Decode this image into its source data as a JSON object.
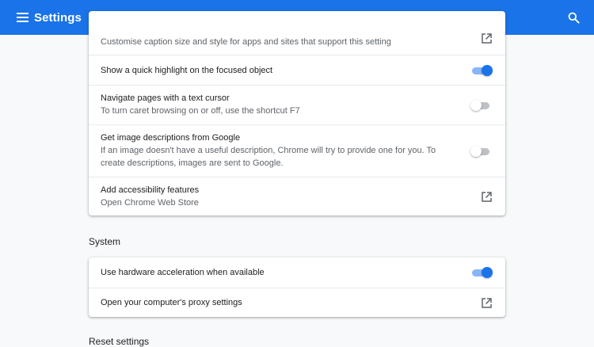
{
  "header": {
    "title": "Settings",
    "menu_icon": "hamburger-menu-icon",
    "search_icon": "search-icon",
    "background": "#1a73e8"
  },
  "accessibility": {
    "items": [
      {
        "primary": "",
        "secondary": "Customise caption size and style for apps and sites that support this setting",
        "control": "external-link"
      },
      {
        "primary": "Show a quick highlight on the focused object",
        "control": "toggle",
        "state": "on"
      },
      {
        "primary": "Navigate pages with a text cursor",
        "secondary": "To turn caret browsing on or off, use the shortcut F7",
        "control": "toggle",
        "state": "off"
      },
      {
        "primary": "Get image descriptions from Google",
        "secondary": "If an image doesn't have a useful description, Chrome will try to provide one for you. To create descriptions, images are sent to Google.",
        "control": "toggle",
        "state": "off"
      },
      {
        "primary": "Add accessibility features",
        "secondary": "Open Chrome Web Store",
        "control": "external-link"
      }
    ]
  },
  "system": {
    "title": "System",
    "items": [
      {
        "primary": "Use hardware acceleration when available",
        "control": "toggle",
        "state": "on"
      },
      {
        "primary": "Open your computer's proxy settings",
        "control": "external-link"
      }
    ]
  },
  "next_section": {
    "title": "Reset settings"
  },
  "colors": {
    "accent": "#1a73e8",
    "toggle_on_track": "#8ab4f8",
    "toggle_off_track": "#bdc1c6",
    "page_background": "#f8f9fa"
  }
}
